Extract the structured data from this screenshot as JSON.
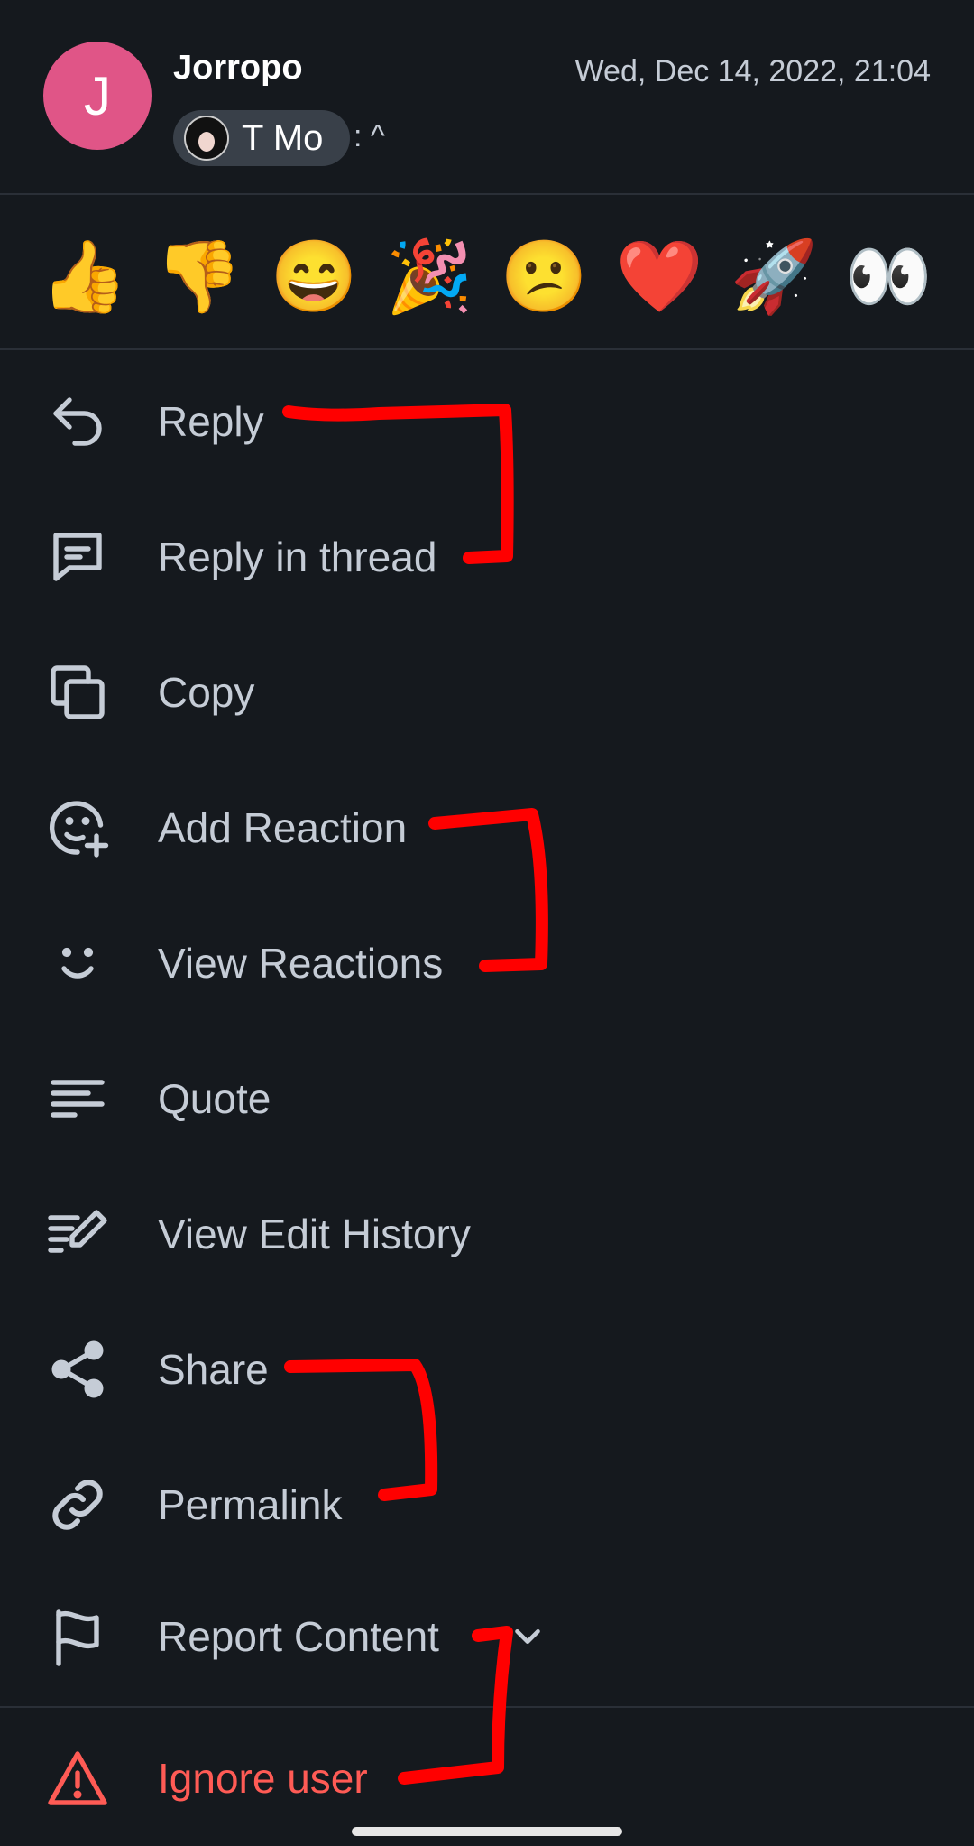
{
  "message": {
    "sender": "Jorropo",
    "avatar_initial": "J",
    "timestamp": "Wed, Dec 14, 2022, 21:04",
    "mention_name": "T Mo",
    "mention_suffix": ": ^"
  },
  "quick_reactions": [
    "👍",
    "👎",
    "😄",
    "🎉",
    "😕",
    "❤️",
    "🚀",
    "👀"
  ],
  "menu": {
    "reply": "Reply",
    "reply_in_thread": "Reply in thread",
    "copy": "Copy",
    "add_reaction": "Add Reaction",
    "view_reactions": "View Reactions",
    "quote": "Quote",
    "view_edit_history": "View Edit History",
    "share": "Share",
    "permalink": "Permalink",
    "report_content": "Report Content",
    "ignore_user": "Ignore user"
  },
  "colors": {
    "background": "#15191e",
    "text": "#c5ccd6",
    "danger": "#ff5b55",
    "avatar": "#e05587",
    "annotation": "#ff0000"
  }
}
